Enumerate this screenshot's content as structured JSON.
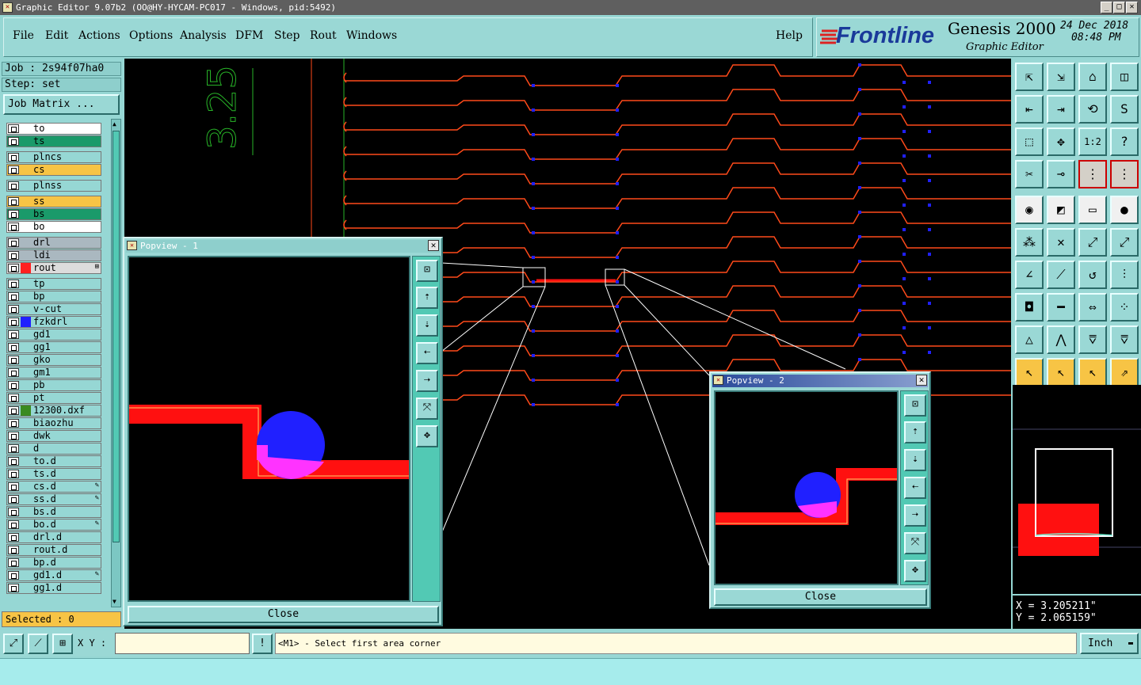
{
  "window": {
    "title": "Graphic Editor 9.07b2 (OO@HY-HYCAM-PC017 - Windows, pid:5492)"
  },
  "menu": [
    "File",
    "Edit",
    "Actions",
    "Options",
    "Analysis",
    "DFM",
    "Step",
    "Rout",
    "Windows"
  ],
  "help": "Help",
  "brand": {
    "logo": "Frontline",
    "product": "Genesis 2000",
    "subtitle": "Graphic Editor",
    "date": "24 Dec 2018",
    "time": "08:48 PM"
  },
  "job": {
    "label": "Job : 2s94f07ha0",
    "step": "Step: set",
    "matrix_button": "Job Matrix ..."
  },
  "layers": [
    {
      "name": "to",
      "bg": "#ffffff"
    },
    {
      "name": "ts",
      "bg": "#1a9a6a"
    },
    {
      "name": "plncs",
      "bg": "#96d7d4"
    },
    {
      "name": "cs",
      "bg": "#f7c445"
    },
    {
      "name": "plnss",
      "bg": "#96d7d4"
    },
    {
      "name": "ss",
      "bg": "#f7c445"
    },
    {
      "name": "bs",
      "bg": "#1a9a6a"
    },
    {
      "name": "bo",
      "bg": "#ffffff"
    },
    {
      "name": "drl",
      "bg": "#aab8c0"
    },
    {
      "name": "ldi",
      "bg": "#aab8c0"
    },
    {
      "name": "rout",
      "bg": "#dcdcdc",
      "swatch": "#ff2020",
      "mark": "⊞"
    },
    {
      "name": "tp",
      "bg": "#96d7d4"
    },
    {
      "name": "bp",
      "bg": "#96d7d4"
    },
    {
      "name": "v-cut",
      "bg": "#96d7d4"
    },
    {
      "name": "fzkdrl",
      "bg": "#96d7d4",
      "swatch": "#2020ff"
    },
    {
      "name": "gd1",
      "bg": "#96d7d4"
    },
    {
      "name": "gg1",
      "bg": "#96d7d4"
    },
    {
      "name": "gko",
      "bg": "#96d7d4"
    },
    {
      "name": "gm1",
      "bg": "#96d7d4"
    },
    {
      "name": "pb",
      "bg": "#96d7d4"
    },
    {
      "name": "pt",
      "bg": "#96d7d4"
    },
    {
      "name": "12300.dxf",
      "bg": "#96d7d4",
      "swatch": "#3a8a20"
    },
    {
      "name": "biaozhu",
      "bg": "#96d7d4"
    },
    {
      "name": "dwk",
      "bg": "#96d7d4"
    },
    {
      "name": "d",
      "bg": "#96d7d4"
    },
    {
      "name": "to.d",
      "bg": "#96d7d4"
    },
    {
      "name": "ts.d",
      "bg": "#96d7d4"
    },
    {
      "name": "cs.d",
      "bg": "#96d7d4",
      "mark": "✎"
    },
    {
      "name": "ss.d",
      "bg": "#96d7d4",
      "mark": "✎"
    },
    {
      "name": "bs.d",
      "bg": "#96d7d4"
    },
    {
      "name": "bo.d",
      "bg": "#96d7d4",
      "mark": "✎"
    },
    {
      "name": "drl.d",
      "bg": "#96d7d4"
    },
    {
      "name": "rout.d",
      "bg": "#96d7d4"
    },
    {
      "name": "bp.d",
      "bg": "#96d7d4"
    },
    {
      "name": "gd1.d",
      "bg": "#96d7d4",
      "mark": "✎"
    },
    {
      "name": "gg1.d",
      "bg": "#96d7d4"
    }
  ],
  "selected": "Selected : 0",
  "canvas_text": "3.25",
  "popview1": {
    "title": "Popview - 1",
    "close": "Close"
  },
  "popview2": {
    "title": "Popview - 2",
    "close": "Close"
  },
  "coords": {
    "x": "X = 3.205211\"",
    "y": "Y = 2.065159\""
  },
  "prompt": {
    "label": "X Y :",
    "value": "",
    "message": "<M1> - Select first area corner"
  },
  "units": "Inch",
  "colors": {
    "trace": "#ff4a1a",
    "pad": "#2020ff",
    "rout_red": "#ff1010"
  }
}
